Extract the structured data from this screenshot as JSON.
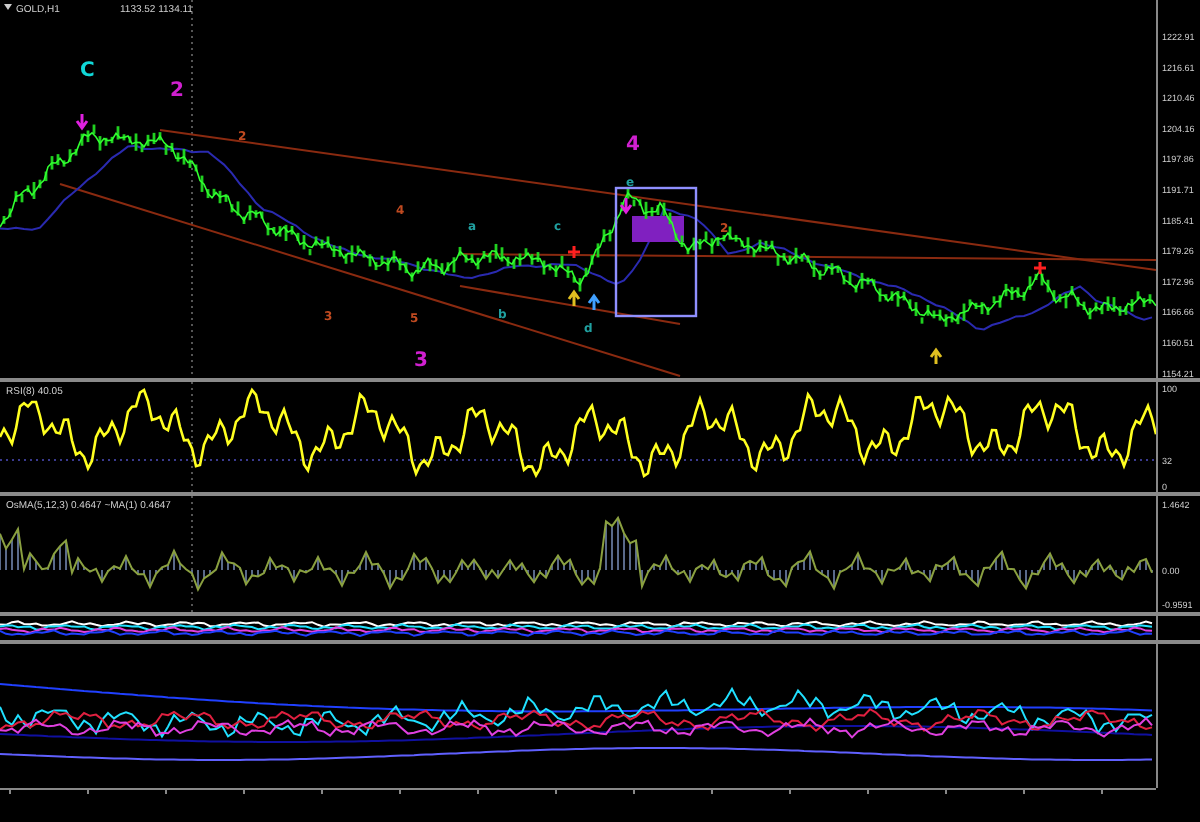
{
  "header": {
    "symbol": "GOLD,H1",
    "prices": "1133.52 1134.11"
  },
  "price_axis": [
    "1222.91",
    "1216.61",
    "1210.46",
    "1204.16",
    "1197.86",
    "1191.71",
    "1185.41",
    "1179.26",
    "1172.96",
    "1166.66",
    "1160.51",
    "1154.21"
  ],
  "wave_labels": [
    {
      "text": "C",
      "color": "#10d8d8"
    },
    {
      "text": "2",
      "color": "#d020d0"
    },
    {
      "text": "2",
      "color": "#c04a20"
    },
    {
      "text": "3",
      "color": "#c04a20"
    },
    {
      "text": "4",
      "color": "#c04a20"
    },
    {
      "text": "5",
      "color": "#c04a20"
    },
    {
      "text": "3",
      "color": "#d020d0"
    },
    {
      "text": "a",
      "color": "#20a0a0"
    },
    {
      "text": "b",
      "color": "#20a0a0"
    },
    {
      "text": "c",
      "color": "#20a0a0"
    },
    {
      "text": "d",
      "color": "#20a0a0"
    },
    {
      "text": "4",
      "color": "#d020d0"
    },
    {
      "text": "e",
      "color": "#20a0a0"
    },
    {
      "text": "2",
      "color": "#c04a20"
    }
  ],
  "rsi": {
    "label": "RSI(8) 40.05",
    "axis": [
      "100",
      "32",
      "0"
    ]
  },
  "osma": {
    "label": "OsMA(5,12,3) 0.4647  ~MA(1) 0.4647",
    "axis": [
      "1.4642",
      "0.00",
      "-0.9591"
    ]
  }
}
